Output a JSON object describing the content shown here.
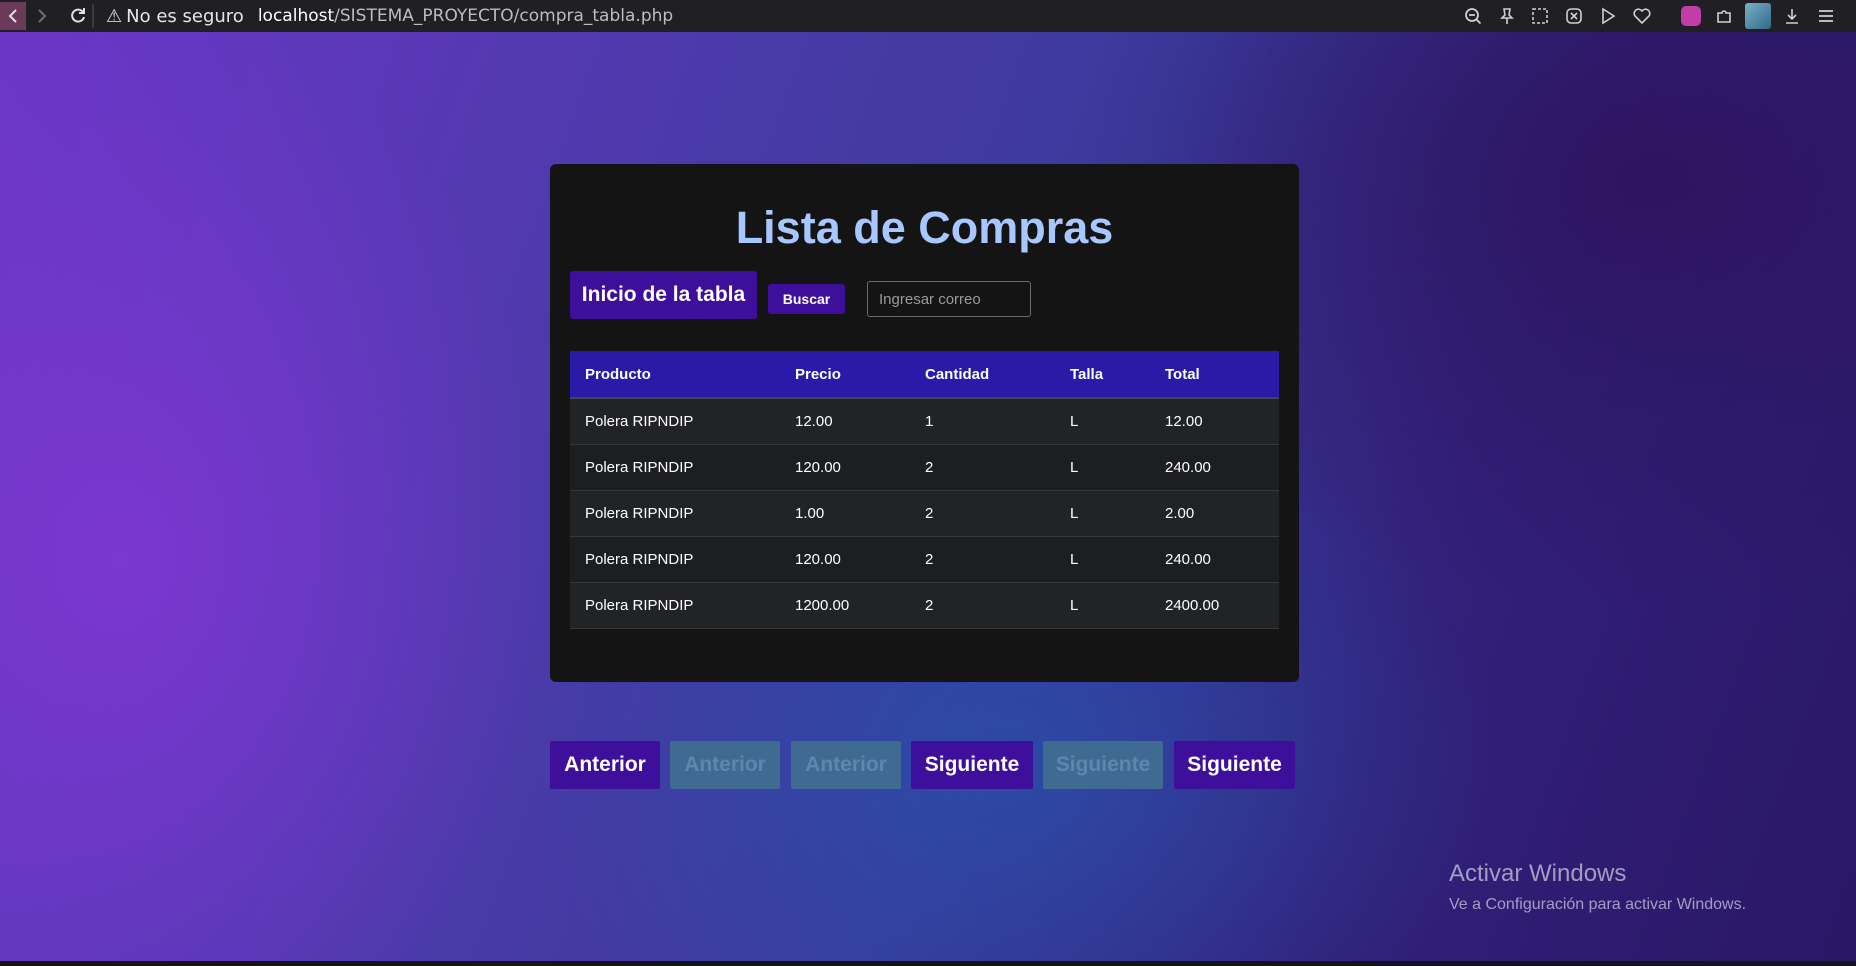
{
  "browser": {
    "security_label": "No es seguro",
    "url_host": "localhost",
    "url_path": "/SISTEMA_PROYECTO/compra_tabla.php"
  },
  "page": {
    "title": "Lista de Compras",
    "inicio_label": "Inicio de la tabla",
    "buscar_label": "Buscar",
    "search_placeholder": "Ingresar correo",
    "search_value": ""
  },
  "table": {
    "headers": [
      "Producto",
      "Precio",
      "Cantidad",
      "Talla",
      "Total"
    ],
    "rows": [
      [
        "Polera RIPNDIP",
        "12.00",
        "1",
        "L",
        "12.00"
      ],
      [
        "Polera RIPNDIP",
        "120.00",
        "2",
        "L",
        "240.00"
      ],
      [
        "Polera RIPNDIP",
        "1.00",
        "2",
        "L",
        "2.00"
      ],
      [
        "Polera RIPNDIP",
        "120.00",
        "2",
        "L",
        "240.00"
      ],
      [
        "Polera RIPNDIP",
        "1200.00",
        "2",
        "L",
        "2400.00"
      ]
    ]
  },
  "pagination": [
    {
      "label": "Anterior",
      "state": "active"
    },
    {
      "label": "Anterior",
      "state": "disabled"
    },
    {
      "label": "Anterior",
      "state": "disabled"
    },
    {
      "label": "Siguiente",
      "state": "active"
    },
    {
      "label": "Siguiente",
      "state": "disabled"
    },
    {
      "label": "Siguiente",
      "state": "active"
    }
  ],
  "watermark": {
    "title": "Activar Windows",
    "subtitle": "Ve a Configuración para activar Windows."
  },
  "colors": {
    "accent": "#3d0f9a",
    "table_header": "#2a1aa8",
    "title": "#a9c7ff",
    "disabled_button": "#3f6b93"
  }
}
